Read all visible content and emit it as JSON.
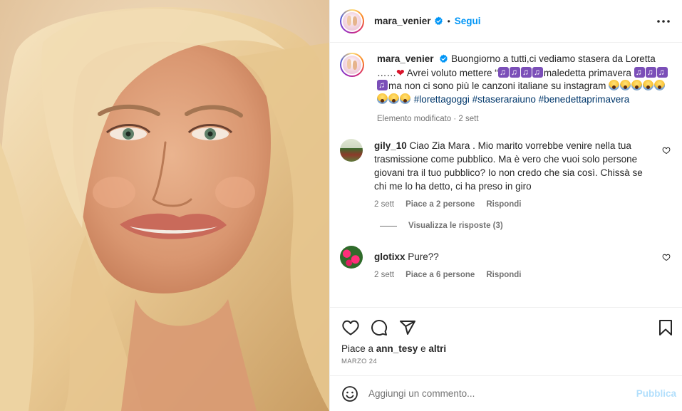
{
  "post": {
    "image_alt": "",
    "header": {
      "username": "mara_venier",
      "separator": "•",
      "follow_label": "Segui"
    },
    "caption": {
      "username": "mara_venier",
      "text_1": "Buongiorno a tutti,ci vediamo stasera da Loretta ……",
      "text_2": "Avrei voluto mettere “",
      "text_3": "maledetta primavera",
      "text_4": "ma non ci sono più le canzoni italiane su instagram",
      "hashtags": [
        "#lorettagoggi",
        "#staseraraiuno",
        "#benedettaprimavera"
      ],
      "meta": "Elemento modificato · 2 sett"
    },
    "comments": [
      {
        "username": "gily_10",
        "text": "Ciao Zia Mara . Mio marito vorrebbe venire nella tua trasmissione come pubblico. Ma è vero che vuoi solo persone giovani tra il tuo pubblico? Io non credo che sia così. Chissà se chi me lo ha detto, ci ha preso in giro",
        "time": "2 sett",
        "likes": "Piace a 2 persone",
        "reply": "Rispondi",
        "view_replies": "Visualizza le risposte (3)"
      },
      {
        "username": "glotixx",
        "text": "Pure??",
        "time": "2 sett",
        "likes": "Piace a 6 persone",
        "reply": "Rispondi"
      }
    ],
    "likes": {
      "prefix": "Piace a ",
      "user": "ann_tesy",
      "suffix": " e ",
      "others": "altri"
    },
    "date": "MARZO 24",
    "add_comment": {
      "placeholder": "Aggiungi un commento...",
      "publish_label": "Pubblica"
    }
  },
  "colors": {
    "accent": "#0095f6",
    "publish_disabled": "#b2dffc",
    "hashtag": "#00376b",
    "muted": "#737373"
  },
  "icons": [
    "verified-badge-icon",
    "more-options-icon",
    "heart-icon",
    "comment-icon",
    "share-icon",
    "bookmark-icon",
    "emoji-icon"
  ]
}
